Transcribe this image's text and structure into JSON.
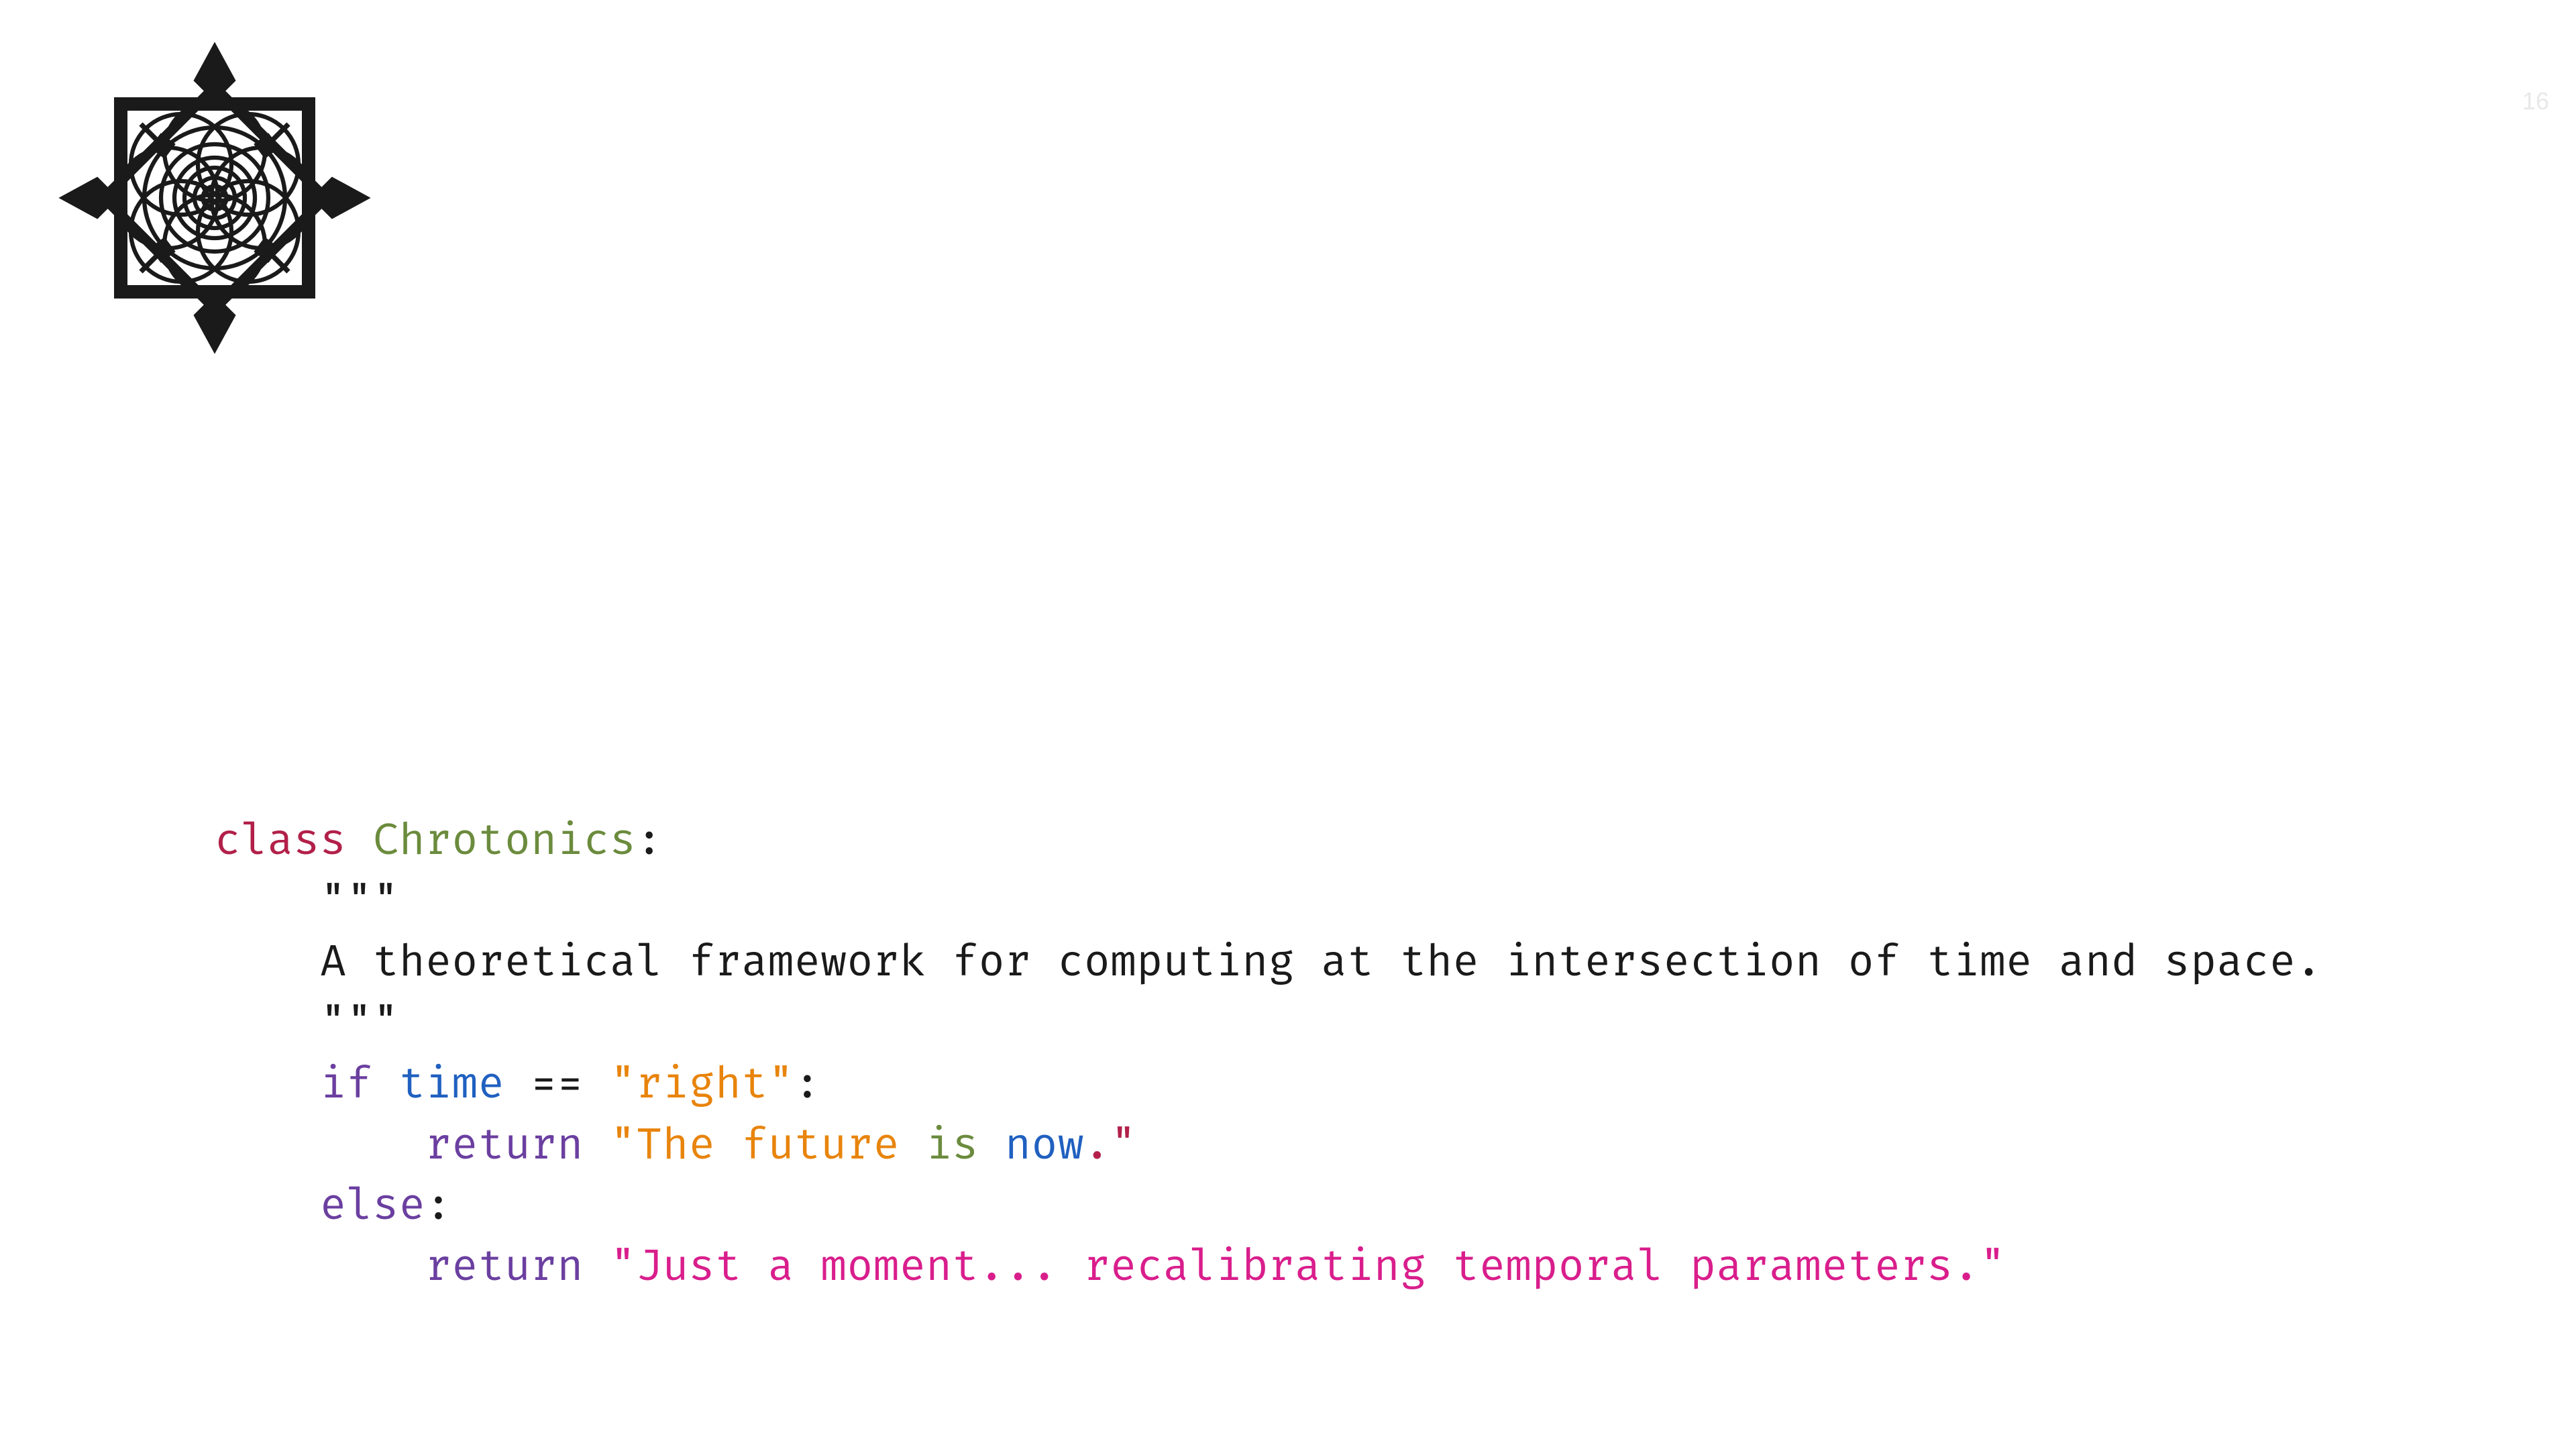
{
  "page_number": "16",
  "code": {
    "line1": {
      "kw_class": "class",
      "space1": " ",
      "cls_name": "Chrotonics",
      "colon": ":"
    },
    "line2": {
      "indent": "    ",
      "triple_quote": "\"\"\""
    },
    "line3": {
      "indent": "    ",
      "text": "A theoretical framework for computing at the intersection of time and space."
    },
    "line4": {
      "indent": "    ",
      "triple_quote": "\"\"\""
    },
    "line5": {
      "indent": "    ",
      "kw_if": "if",
      "space1": " ",
      "var": "time",
      "space2": " ",
      "op": "==",
      "space3": " ",
      "str": "\"right\"",
      "colon": ":"
    },
    "line6": {
      "indent": "        ",
      "kw_return": "return",
      "space1": " ",
      "q1": "\"",
      "w1": "The",
      "sp1": " ",
      "w2": "future",
      "sp2": " ",
      "w3": "is",
      "sp3": " ",
      "w4": "now",
      "dot": ".",
      "q2": "\""
    },
    "line7": {
      "indent": "    ",
      "kw_else": "else",
      "colon": ":"
    },
    "line8": {
      "indent": "        ",
      "kw_return": "return",
      "space1": " ",
      "str": "\"Just a moment... recalibrating temporal parameters.\""
    }
  }
}
